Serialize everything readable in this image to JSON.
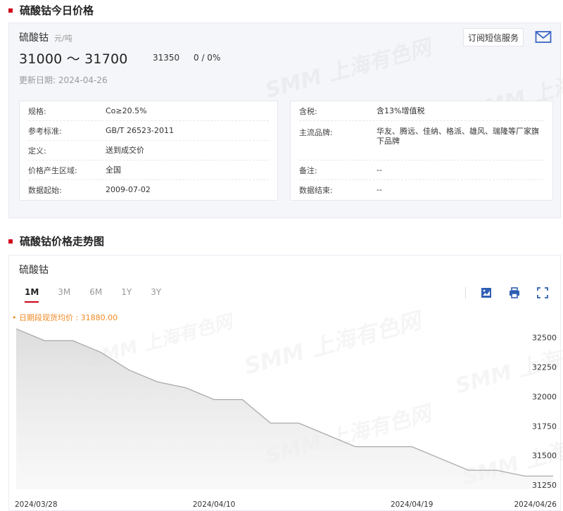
{
  "section1": {
    "title": "硫酸钴今日价格"
  },
  "price": {
    "product": "硫酸钴",
    "unit": "元/吨",
    "range": "31000 ～ 31700",
    "average": "31350",
    "change": "0  /  0%",
    "update_label": "更新日期:",
    "update_date": "2024-04-26",
    "subscribe": "订阅短信服务"
  },
  "specs_left": [
    {
      "label": "规格:",
      "value": "Co≥20.5%"
    },
    {
      "label": "参考标准:",
      "value": "GB/T 26523-2011"
    },
    {
      "label": "定义:",
      "value": "送到成交价"
    },
    {
      "label": "价格产生区域:",
      "value": "全国"
    },
    {
      "label": "数据起始:",
      "value": "2009-07-02"
    }
  ],
  "specs_right": [
    {
      "label": "含税:",
      "value": "含13%增值税"
    },
    {
      "label": "主流品牌:",
      "value": "华友、腾远、佳纳、格派、雄风、瑞隆等厂家旗下品牌"
    },
    {
      "label": "备注:",
      "value": "--"
    },
    {
      "label": "数据结束:",
      "value": "--"
    }
  ],
  "watermark": {
    "text": "SMM 上海有色网"
  },
  "section2": {
    "title": "硫酸钴价格走势图"
  },
  "chart": {
    "title": "硫酸钴",
    "tabs": [
      "1M",
      "3M",
      "6M",
      "1Y",
      "3Y"
    ],
    "active_tab": "1M",
    "avg_note": "• 日期段现货均价 : 31880.00"
  },
  "colors": {
    "accent": "#d0021b",
    "line": "#aaaaaa",
    "note": "#f08a24"
  },
  "chart_data": {
    "type": "area",
    "x": [
      "2024-03-28",
      "2024-03-29",
      "2024-04-01",
      "2024-04-02",
      "2024-04-03",
      "2024-04-08",
      "2024-04-09",
      "2024-04-10",
      "2024-04-11",
      "2024-04-12",
      "2024-04-15",
      "2024-04-16",
      "2024-04-17",
      "2024-04-18",
      "2024-04-19",
      "2024-04-22",
      "2024-04-23",
      "2024-04-24",
      "2024-04-25",
      "2024-04-26"
    ],
    "values": [
      32575,
      32475,
      32475,
      32375,
      32225,
      32125,
      32075,
      31975,
      31975,
      31775,
      31775,
      31675,
      31575,
      31575,
      31575,
      31475,
      31375,
      31375,
      31325,
      31325
    ],
    "x_tick_labels": [
      "2024/03/28",
      "2024/04/10",
      "2024/04/19",
      "2024/04/26"
    ],
    "x_tick_index": [
      0,
      7,
      14,
      19
    ],
    "y_ticks": [
      31250,
      31500,
      31750,
      32000,
      32250,
      32500
    ],
    "ylim": [
      31250,
      32600
    ],
    "grid": false
  }
}
